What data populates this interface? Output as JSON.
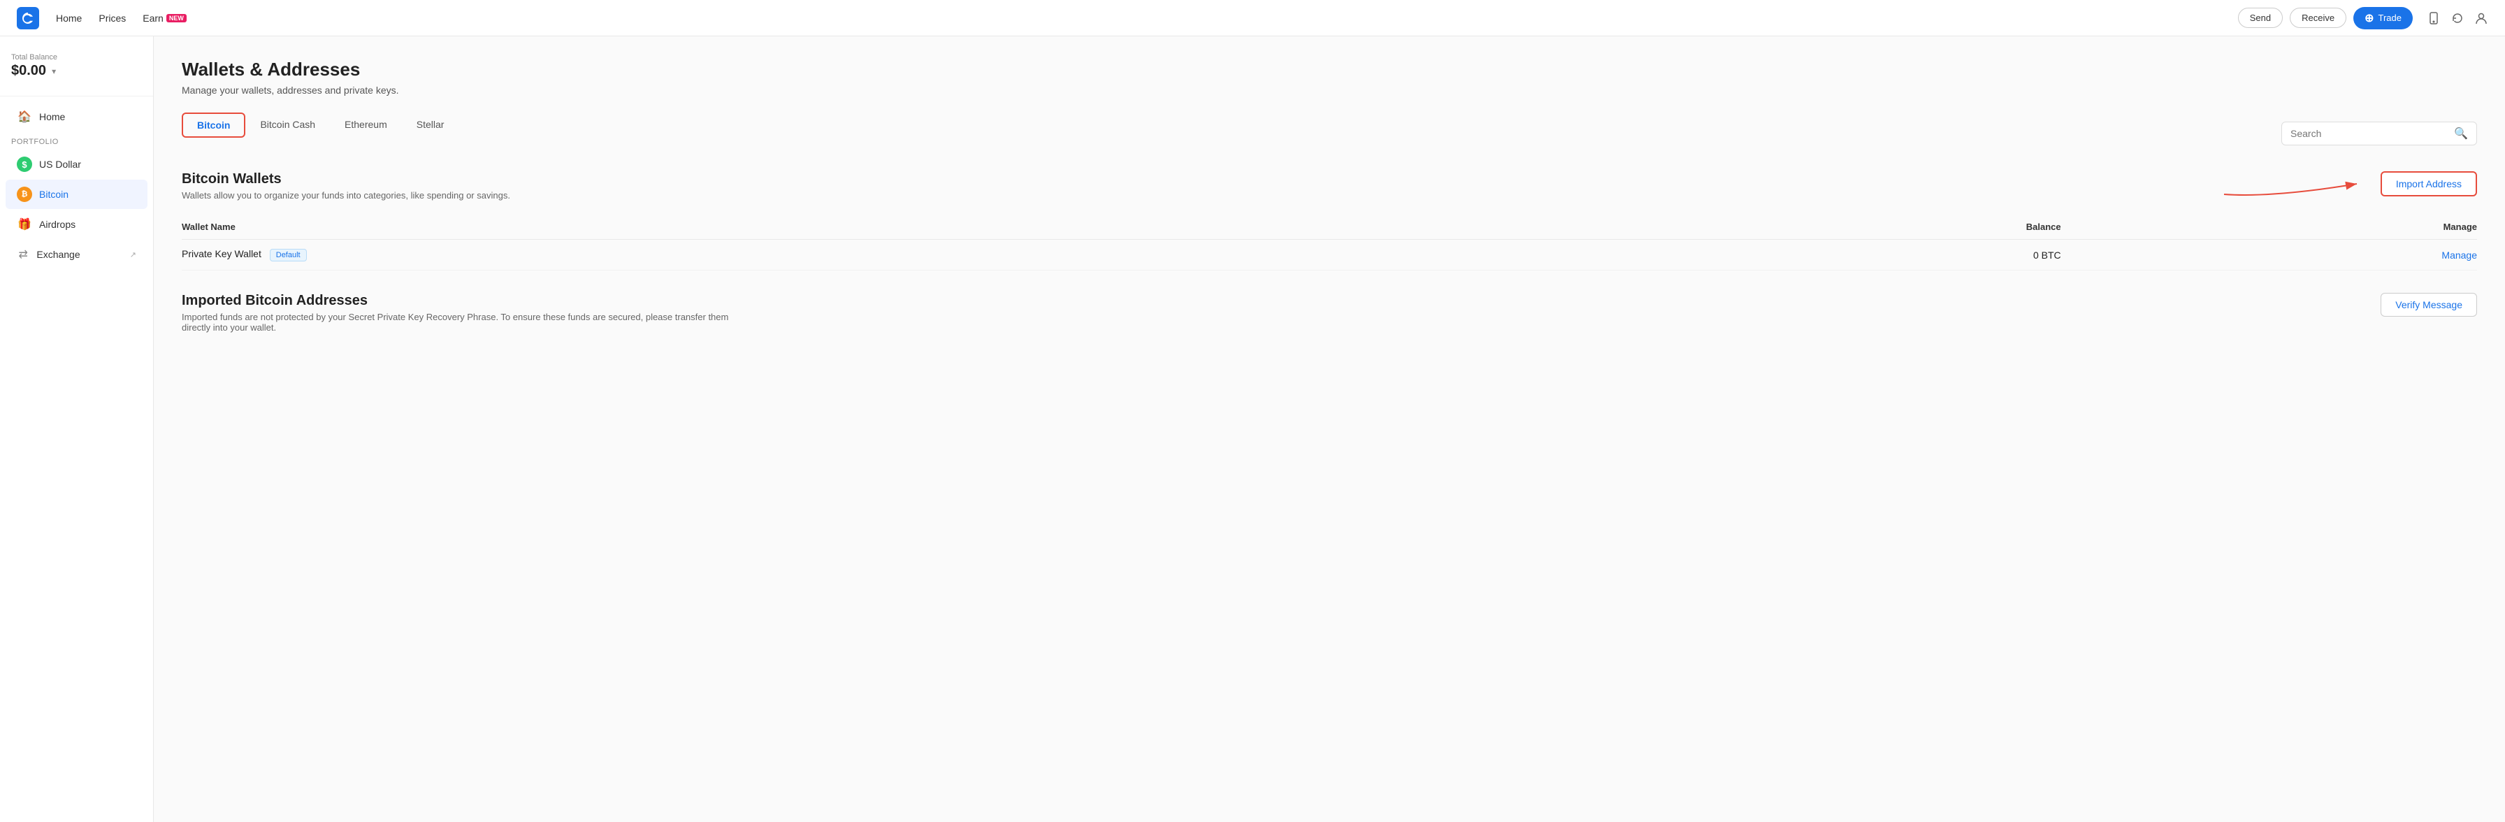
{
  "topnav": {
    "logo_label": "Coinbase",
    "links": [
      {
        "id": "home",
        "label": "Home"
      },
      {
        "id": "prices",
        "label": "Prices"
      },
      {
        "id": "earn",
        "label": "Earn",
        "badge": "NEW"
      }
    ],
    "send_label": "Send",
    "receive_label": "Receive",
    "trade_label": "Trade"
  },
  "sidebar": {
    "balance_label": "Total Balance",
    "balance_amount": "$0.00",
    "nav_items": [
      {
        "id": "home",
        "label": "Home",
        "icon": "home"
      },
      {
        "id": "portfolio",
        "label": "Portfolio",
        "type": "section"
      },
      {
        "id": "usdollar",
        "label": "US Dollar",
        "icon": "usd"
      },
      {
        "id": "bitcoin",
        "label": "Bitcoin",
        "icon": "btc"
      },
      {
        "id": "airdrops",
        "label": "Airdrops",
        "icon": "gift"
      },
      {
        "id": "exchange",
        "label": "Exchange",
        "icon": "exchange",
        "ext": true
      }
    ]
  },
  "page": {
    "title": "Wallets & Addresses",
    "subtitle": "Manage your wallets, addresses and private keys.",
    "tabs": [
      {
        "id": "bitcoin",
        "label": "Bitcoin",
        "active": true
      },
      {
        "id": "bitcoincash",
        "label": "Bitcoin Cash"
      },
      {
        "id": "ethereum",
        "label": "Ethereum"
      },
      {
        "id": "stellar",
        "label": "Stellar"
      }
    ],
    "search": {
      "placeholder": "Search"
    },
    "wallets_section": {
      "title": "Bitcoin Wallets",
      "subtitle": "Wallets allow you to organize your funds into categories, like spending or savings.",
      "table": {
        "columns": [
          "Wallet Name",
          "Balance",
          "Manage"
        ],
        "rows": [
          {
            "name": "Private Key Wallet",
            "badge": "Default",
            "balance": "0 BTC",
            "manage": "Manage"
          }
        ]
      }
    },
    "import_section": {
      "title": "Imported Bitcoin Addresses",
      "subtitle": "Imported funds are not protected by your Secret Private Key Recovery Phrase. To ensure these funds are secured, please transfer them directly into your wallet.",
      "import_btn": "Import Address",
      "verify_btn": "Verify Message"
    }
  }
}
